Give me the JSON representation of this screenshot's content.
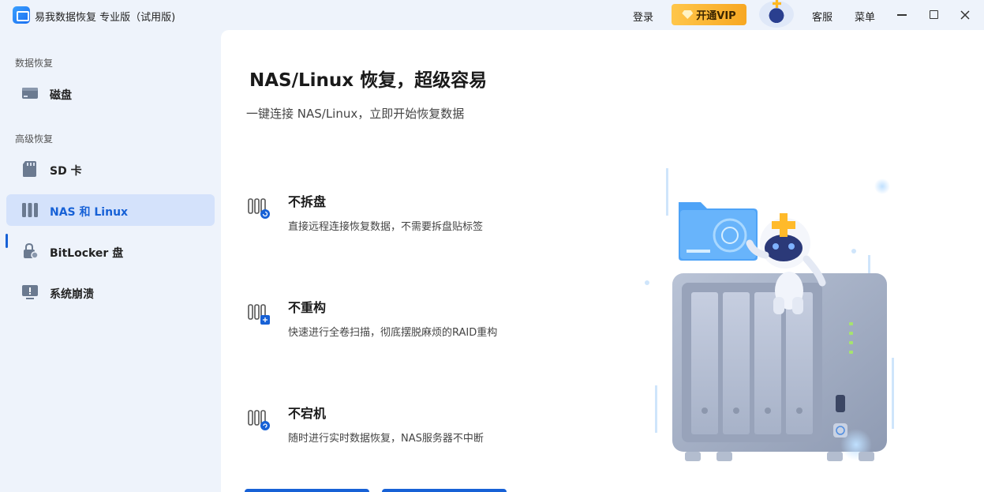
{
  "app": {
    "title": "易我数据恢复 专业版（试用版)"
  },
  "titlebar": {
    "login": "登录",
    "vip": "开通VIP",
    "support": "客服",
    "menu": "菜单"
  },
  "sidebar": {
    "section1": "数据恢复",
    "section2": "高级恢复",
    "items": [
      {
        "label": "磁盘",
        "icon": "disk-icon"
      },
      {
        "label": "SD 卡",
        "icon": "sd-card-icon"
      },
      {
        "label": "NAS 和 Linux",
        "icon": "nas-icon"
      },
      {
        "label": "BitLocker 盘",
        "icon": "bitlocker-lock-icon"
      },
      {
        "label": "系统崩溃",
        "icon": "system-crash-icon"
      }
    ],
    "active_index": 2
  },
  "main": {
    "headline": "NAS/Linux 恢复，超级容易",
    "subline": "一键连接 NAS/Linux，立即开始恢复数据",
    "features": [
      {
        "title": "不拆盘",
        "desc": "直接远程连接恢复数据，不需要拆盘贴标签",
        "icon": "nas-remote-icon"
      },
      {
        "title": "不重构",
        "desc": "快速进行全卷扫描，彻底摆脱麻烦的RAID重构",
        "icon": "nas-scan-icon"
      },
      {
        "title": "不宕机",
        "desc": "随时进行实时数据恢复，NAS服务器不中断",
        "icon": "nas-realtime-icon"
      }
    ]
  },
  "colors": {
    "accent": "#1761d6",
    "sidebar_bg": "#eef3fb",
    "active_bg": "#d4e2fb",
    "vip": "#f7a722"
  }
}
